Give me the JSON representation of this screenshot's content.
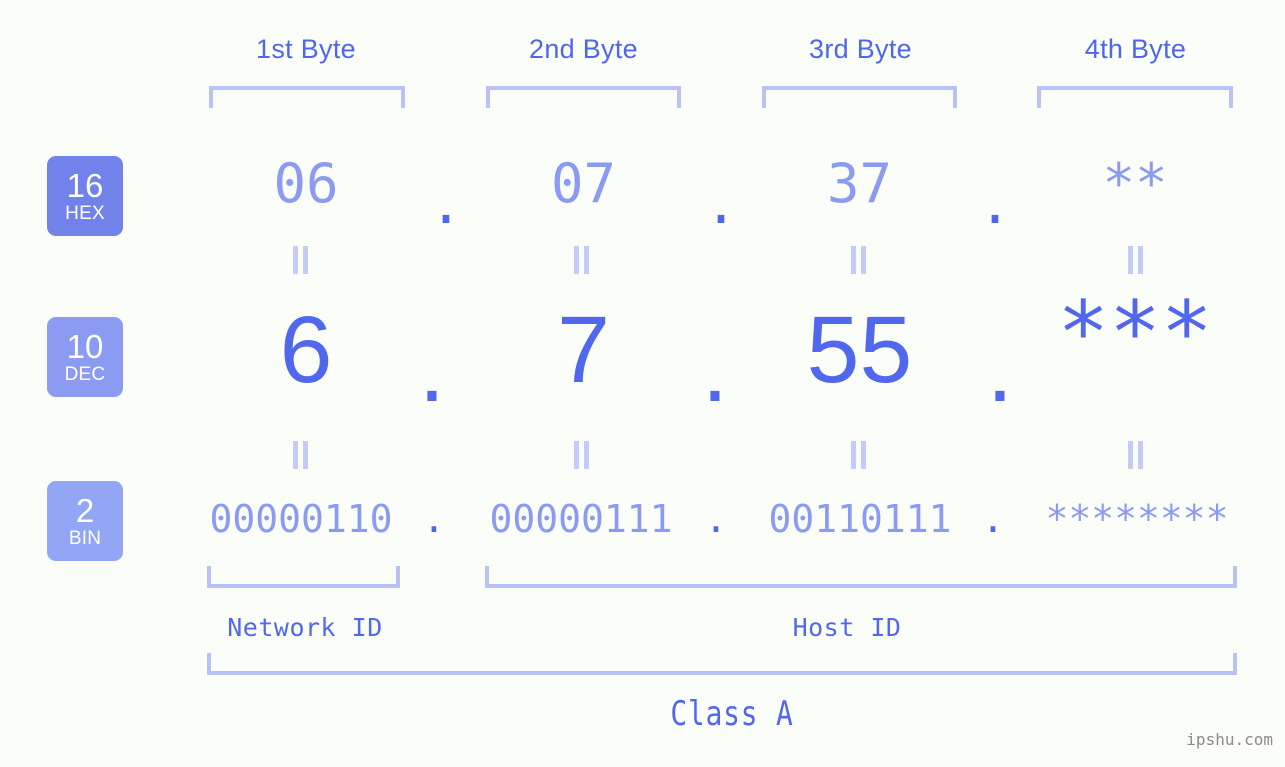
{
  "meta": {
    "background": "#fbfdf8",
    "accent_dark": "#4f66ef",
    "accent_mid": "#5168ee",
    "accent_light": "#8b9bf2",
    "bracket_color": "#b9c2f5",
    "watermark": "ipshu.com"
  },
  "byte_headers": [
    {
      "label": "1st Byte"
    },
    {
      "label": "2nd Byte"
    },
    {
      "label": "3rd Byte"
    },
    {
      "label": "4th Byte"
    }
  ],
  "bases": [
    {
      "number": "16",
      "name": "HEX",
      "color": "#7183ea"
    },
    {
      "number": "10",
      "name": "DEC",
      "color": "#8b9bf2"
    },
    {
      "number": "2",
      "name": "BIN",
      "color": "#92a6f5"
    }
  ],
  "rows": {
    "hex": {
      "values": [
        "06",
        "07",
        "37",
        "**"
      ],
      "separators": [
        ".",
        ".",
        "."
      ]
    },
    "dec": {
      "values": [
        "6",
        "7",
        "55",
        "***"
      ],
      "separators": [
        ".",
        ".",
        "."
      ]
    },
    "bin": {
      "values": [
        "00000110",
        "00000111",
        "00110111",
        "********"
      ],
      "separators": [
        ".",
        ".",
        "."
      ]
    }
  },
  "id_sections": [
    {
      "label": "Network ID"
    },
    {
      "label": "Host ID"
    }
  ],
  "class": {
    "label": "Class A"
  }
}
